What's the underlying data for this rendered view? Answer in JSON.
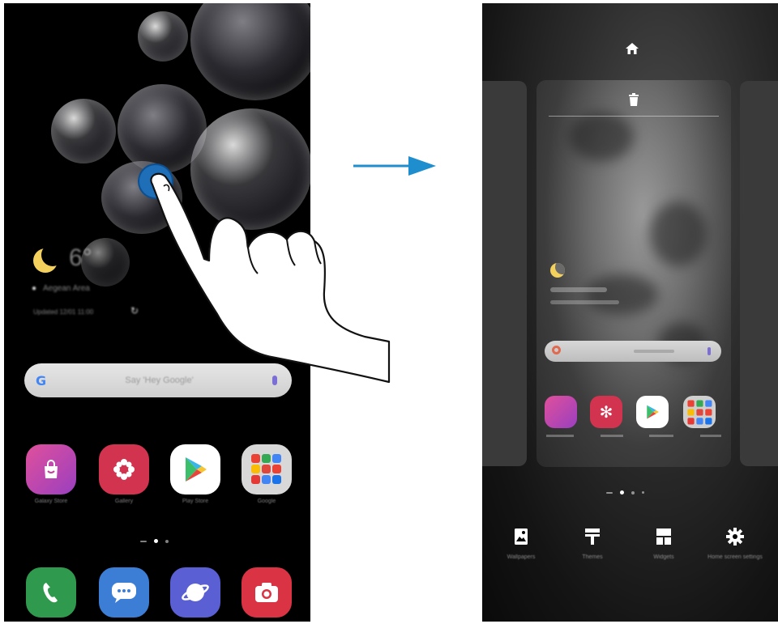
{
  "left_screen": {
    "weather": {
      "temp": "6°",
      "location": "Aegean Area",
      "updated": "Updated 12/01 11:00"
    },
    "search": {
      "logo": "G",
      "placeholder": "Say 'Hey Google'"
    },
    "apps": [
      {
        "label": "Galaxy Store",
        "icon": "shopping-bag-icon",
        "color": "#c2439c"
      },
      {
        "label": "Gallery",
        "icon": "flower-icon",
        "color": "#d2334f"
      },
      {
        "label": "Play Store",
        "icon": "play-triangle-icon",
        "color": "#ffffff"
      },
      {
        "label": "Google",
        "icon": "folder-grid-icon",
        "color": "#dadada"
      }
    ],
    "dock": [
      {
        "icon": "phone-icon",
        "color": "#2f9a4e"
      },
      {
        "icon": "message-icon",
        "color": "#3c7ed6"
      },
      {
        "icon": "internet-planet-icon",
        "color": "#5a5fd4"
      },
      {
        "icon": "camera-icon",
        "color": "#d93344"
      }
    ]
  },
  "right_screen": {
    "top_icon": "home-icon",
    "card_icon": "trash-icon",
    "bottom_menu": [
      {
        "label": "Wallpapers",
        "icon": "wallpaper-icon"
      },
      {
        "label": "Themes",
        "icon": "paintbrush-icon"
      },
      {
        "label": "Widgets",
        "icon": "widgets-icon"
      },
      {
        "label": "Home screen settings",
        "icon": "gear-icon"
      }
    ]
  },
  "arrow": {
    "color": "#1e8ecf"
  },
  "touch": {
    "color": "#1e6fb8"
  }
}
